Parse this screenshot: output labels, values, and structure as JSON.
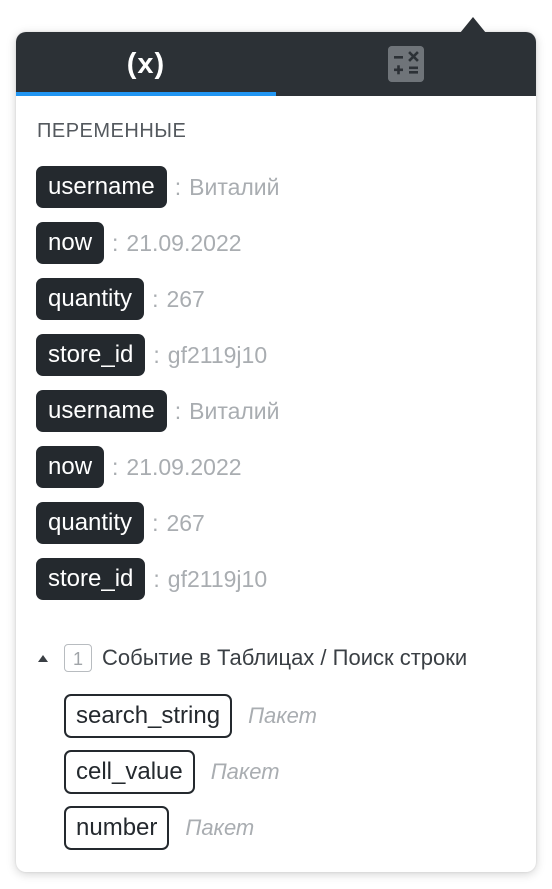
{
  "tabs": [
    {
      "label": "(x)",
      "active": true
    },
    {
      "icon": "calculator-icon",
      "active": false
    }
  ],
  "colors": {
    "header_bg": "#2c3136",
    "active_tab_underline": "#2196f3",
    "chip_dark": "#24292e",
    "muted_text": "#a9adb1"
  },
  "variables": {
    "title": "ПЕРЕМЕННЫЕ",
    "separator": ":",
    "items": [
      {
        "name": "username",
        "value": "Виталий"
      },
      {
        "name": "now",
        "value": "21.09.2022"
      },
      {
        "name": "quantity",
        "value": "267"
      },
      {
        "name": "store_id",
        "value": "gf2119j10"
      },
      {
        "name": "username",
        "value": "Виталий"
      },
      {
        "name": "now",
        "value": "21.09.2022"
      },
      {
        "name": "quantity",
        "value": "267"
      },
      {
        "name": "store_id",
        "value": "gf2119j10"
      }
    ]
  },
  "event": {
    "step": "1",
    "title": "Событие в Таблицах / Поиск строки",
    "expanded": true,
    "fields": [
      {
        "name": "search_string",
        "type": "Пакет"
      },
      {
        "name": "cell_value",
        "type": "Пакет"
      },
      {
        "name": "number",
        "type": "Пакет"
      }
    ]
  }
}
